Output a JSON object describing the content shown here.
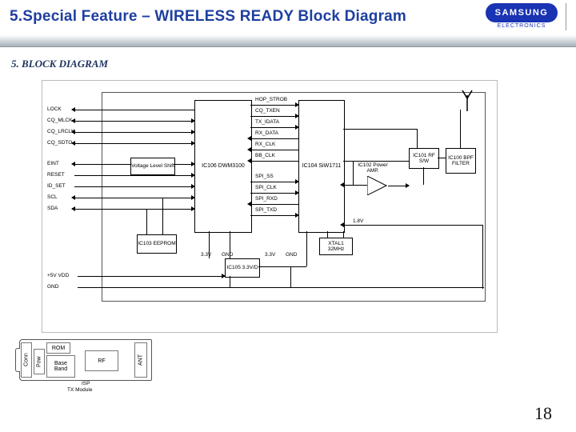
{
  "title": "5.Special Feature – WIRELESS READY Block Diagram",
  "brand": {
    "name": "SAMSUNG",
    "sub": "ELECTRONICS"
  },
  "section": "5. BLOCK DIAGRAM",
  "page": "18",
  "pins": {
    "lock": "LOCK",
    "cq_mlck": "CQ_MLCK",
    "cq_lrclk": "CQ_LRCLK",
    "cq_sdto": "CQ_SDTO",
    "eint": "EINT",
    "reset": "RESET",
    "id_set": "ID_SET",
    "scl": "SCL",
    "sda": "SDA",
    "vdd": "+5V VDD",
    "gnd": "GND"
  },
  "blocks": {
    "vls": "Voltage\nLevel Shift",
    "ic106": "IC106\nDWM3100",
    "ic104": "IC104\nSiW1711",
    "ic102": "IC102\nPower AMP.",
    "ic101": "IC101\nRF S/W",
    "ic100": "IC100\nBPF\nFILTER",
    "ic103": "IC103\nEEPROM",
    "ic105": "IC105\n3.3V/D",
    "xtal": "XTAL1\n32MHz"
  },
  "bus": {
    "hop_strob": "HOP_STROB",
    "cq_txen": "CQ_TXEN",
    "tx_idata": "TX_IDATA",
    "rx_data": "RX_DATA",
    "rx_clk": "RX_CLK",
    "bb_clk": "BB_CLK",
    "spi_ss": "SPI_SS",
    "spi_clk": "SPI_CLK",
    "spi_rxd": "SPI_RXD",
    "spi_txd": "SPI_TXD"
  },
  "power": {
    "v33": "3.3V",
    "gnd": "GND",
    "v18": "1.8V"
  },
  "txmodule": {
    "caption": "TX Module",
    "conn": "Conn",
    "pow": "Pow",
    "rom": "ROM",
    "bb": "Base\nBand",
    "rf": "RF",
    "ant": "ANT",
    "isp": "ISP"
  }
}
